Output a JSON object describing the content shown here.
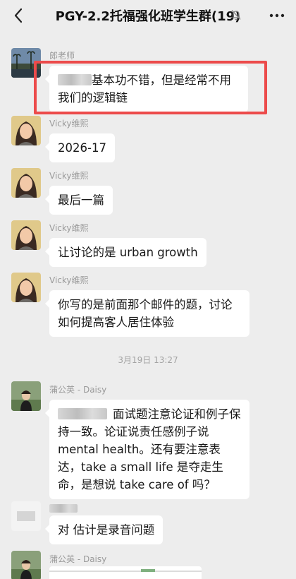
{
  "header": {
    "title": "PGY-2.2托福强化班学生群(19)",
    "back_icon": "chevron-left-icon",
    "mute_icon": "bell-off-icon",
    "more_icon": "more-dots-icon"
  },
  "messages": [
    {
      "sender": "郎老师",
      "text": "基本功不错，但是经常不用我们的逻辑链",
      "highlighted": true
    },
    {
      "sender": "Vicky维熙",
      "text": "2026-17"
    },
    {
      "sender": "Vicky维熙",
      "text": "最后一篇"
    },
    {
      "sender": "Vicky维熙",
      "text": "让讨论的是 urban growth"
    },
    {
      "sender": "Vicky维熙",
      "text": "你写的是前面那个邮件的题，讨论如何提高客人居住体验"
    },
    {
      "timestamp": "3月19日 13:27"
    },
    {
      "sender": "蒲公英 - Daisy",
      "text": "面试题注意论证和例子保持一致。论证说责任感例子说mental health。还有要注意表达，take a small life 是夺走生命，是想说 take care of 吗？"
    },
    {
      "sender": "",
      "text": "对 估计是录音问题"
    },
    {
      "sender": "蒲公英 - Daisy",
      "text": ""
    }
  ],
  "colors": {
    "background": "#ededed",
    "bubble": "#ffffff",
    "highlight": "#ec4b4b",
    "name": "#9a9a9a"
  }
}
